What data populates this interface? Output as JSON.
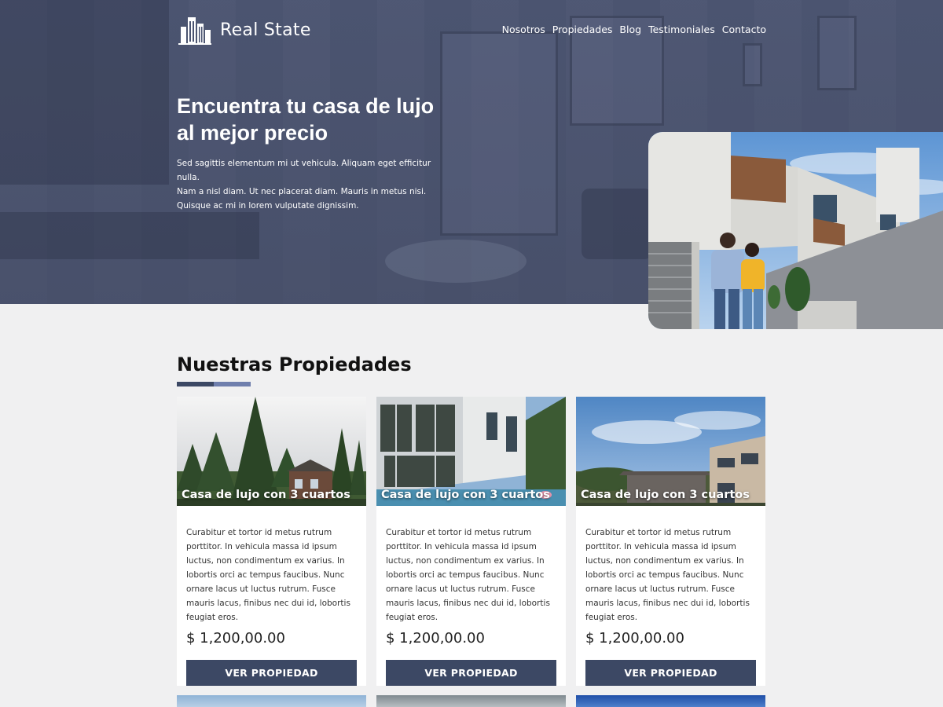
{
  "brand": {
    "name": "Real State"
  },
  "nav": {
    "items": [
      "Nosotros",
      "Propiedades",
      "Blog",
      "Testimoniales",
      "Contacto"
    ]
  },
  "hero": {
    "title_line1": "Encuentra tu casa de lujo",
    "title_line2": "al mejor precio",
    "desc_line1": "Sed sagittis elementum mi ut vehicula. Aliquam eget efficitur nulla.",
    "desc_line2": "Nam a nisl diam. Ut nec placerat diam. Mauris in metus nisi.",
    "desc_line3": "Quisque ac mi in lorem vulputate dignissim."
  },
  "section": {
    "title_light": "Nuestras",
    "title_bold": "Propiedades"
  },
  "cards": [
    {
      "title": "Casa de lujo con 3 cuartos",
      "text": "Curabitur et tortor id metus rutrum porttitor. In vehicula massa id ipsum luctus, non condimentum ex varius. In lobortis orci ac tempus faucibus. Nunc ornare lacus ut luctus rutrum. Fusce mauris lacus, finibus nec dui id, lobortis feugiat eros.",
      "price": "$ 1,200,00.00",
      "button": "VER PROPIEDAD"
    },
    {
      "title": "Casa de lujo con 3 cuartos",
      "text": "Curabitur et tortor id metus rutrum porttitor. In vehicula massa id ipsum luctus, non condimentum ex varius. In lobortis orci ac tempus faucibus. Nunc ornare lacus ut luctus rutrum. Fusce mauris lacus, finibus nec dui id, lobortis feugiat eros.",
      "price": "$ 1,200,00.00",
      "button": "VER PROPIEDAD"
    },
    {
      "title": "Casa de lujo con 3 cuartos",
      "text": "Curabitur et tortor id metus rutrum porttitor. In vehicula massa id ipsum luctus, non condimentum ex varius. In lobortis orci ac tempus faucibus. Nunc ornare lacus ut luctus rutrum. Fusce mauris lacus, finibus nec dui id, lobortis feugiat eros.",
      "price": "$ 1,200,00.00",
      "button": "VER PROPIEDAD"
    }
  ],
  "colors": {
    "primary": "#3c4864",
    "accent": "#6f7fad",
    "hero_overlay": "#4a5370",
    "page_bg": "#f0f0f1"
  }
}
